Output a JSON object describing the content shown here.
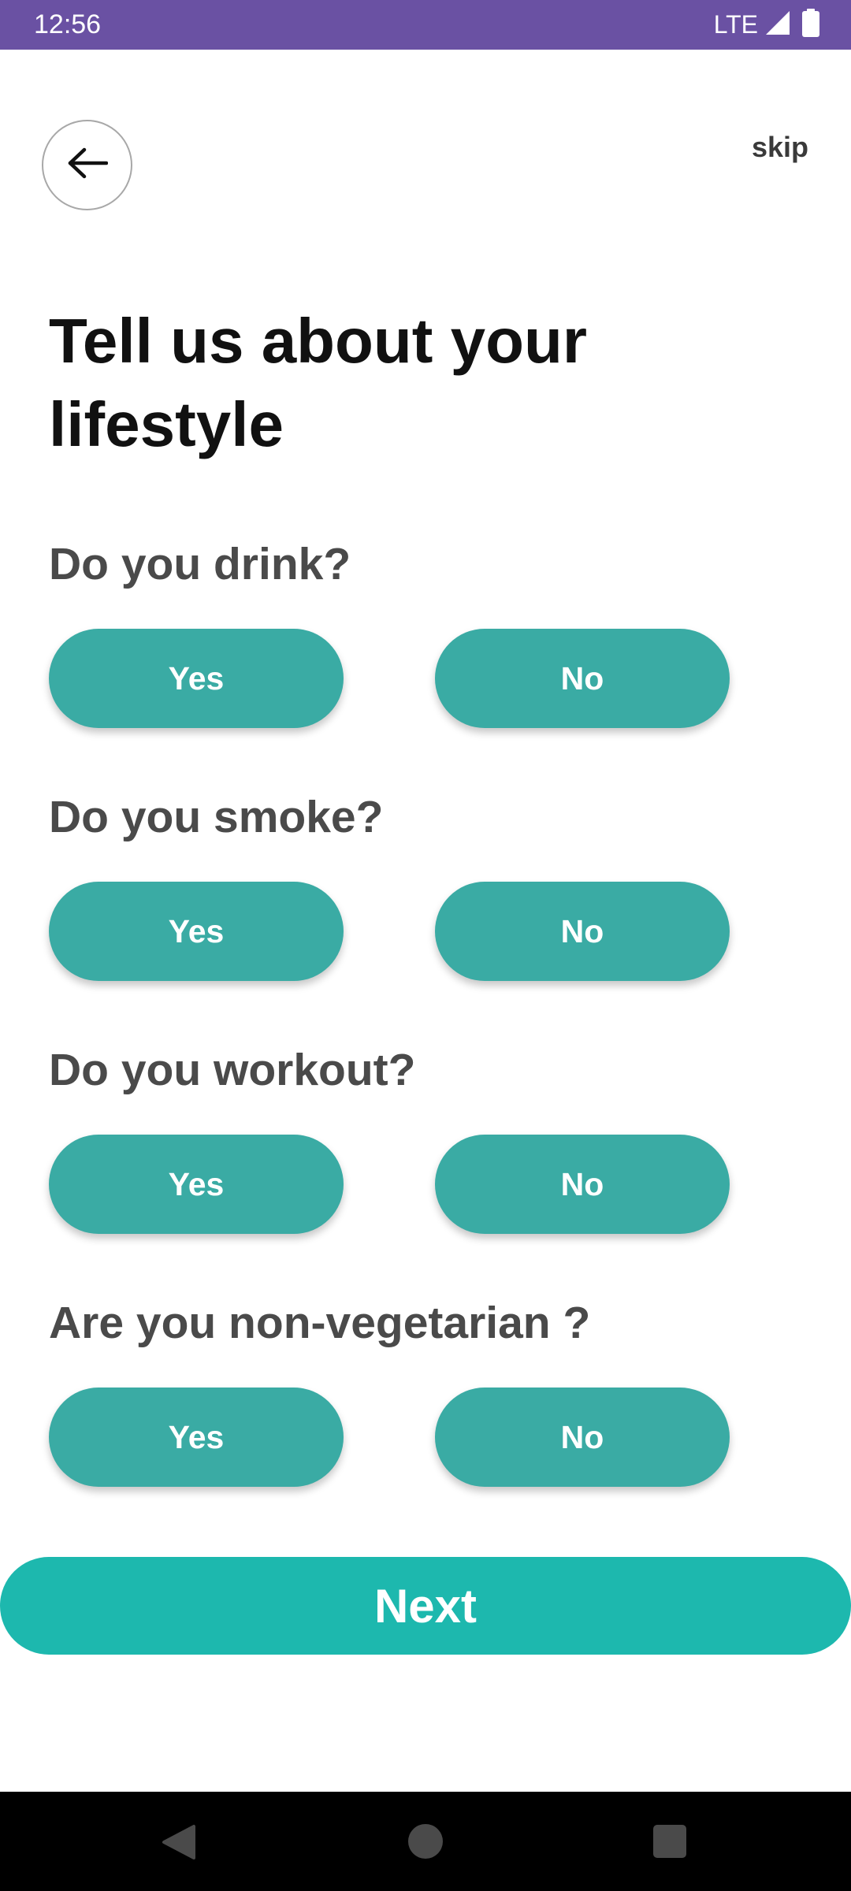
{
  "status_bar": {
    "time": "12:56",
    "network": "LTE",
    "signal_icon": "signal-icon",
    "battery_icon": "battery-icon"
  },
  "header": {
    "back_icon": "arrow-left-icon",
    "skip_label": "skip"
  },
  "title": "Tell us about your lifestyle",
  "questions": [
    {
      "text": "Do you drink?",
      "yes": "Yes",
      "no": "No"
    },
    {
      "text": "Do you smoke?",
      "yes": "Yes",
      "no": "No"
    },
    {
      "text": "Do you workout?",
      "yes": "Yes",
      "no": "No"
    },
    {
      "text": "Are you non-vegetarian ?",
      "yes": "Yes",
      "no": "No"
    }
  ],
  "next_label": "Next",
  "colors": {
    "status_bar": "#6a51a3",
    "choice_button": "#3aaba4",
    "next_button": "#1db8ae",
    "question_text": "#4a4a4a",
    "title_text": "#111111"
  },
  "nav_bar": {
    "back_icon": "nav-back-icon",
    "home_icon": "nav-home-icon",
    "recents_icon": "nav-recents-icon"
  }
}
